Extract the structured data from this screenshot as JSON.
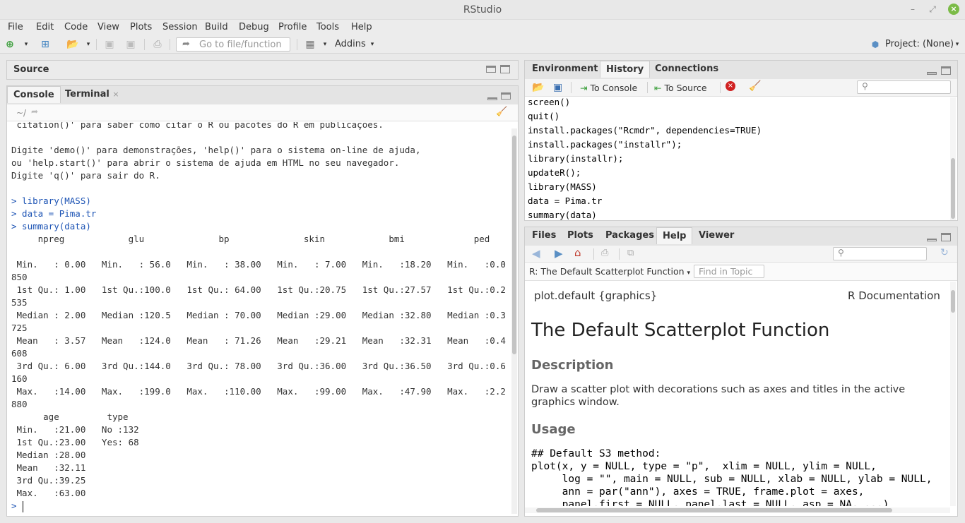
{
  "window": {
    "title": "RStudio"
  },
  "menu": [
    "File",
    "Edit",
    "Code",
    "View",
    "Plots",
    "Session",
    "Build",
    "Debug",
    "Profile",
    "Tools",
    "Help"
  ],
  "toolbar": {
    "goto_placeholder": "Go to file/function",
    "addins_label": "Addins",
    "project_label": "Project: (None)"
  },
  "source_pane": {
    "title": "Source"
  },
  "console_pane": {
    "tabs": [
      "Console",
      "Terminal"
    ],
    "path": "~/",
    "lines": [
      " citation()' para saber como citar o R ou pacotes do R em publicações.",
      "",
      "Digite 'demo()' para demonstrações, 'help()' para o sistema on-line de ajuda,",
      "ou 'help.start()' para abrir o sistema de ajuda em HTML no seu navegador.",
      "Digite 'q()' para sair do R.",
      "",
      "> library(MASS)",
      "> data = Pima.tr",
      "> summary(data)",
      "     npreg            glu              bp              skin            bmi             ped",
      "",
      " Min.   : 0.00   Min.   : 56.0   Min.   : 38.00   Min.   : 7.00   Min.   :18.20   Min.   :0.0",
      "850",
      " 1st Qu.: 1.00   1st Qu.:100.0   1st Qu.: 64.00   1st Qu.:20.75   1st Qu.:27.57   1st Qu.:0.2",
      "535",
      " Median : 2.00   Median :120.5   Median : 70.00   Median :29.00   Median :32.80   Median :0.3",
      "725",
      " Mean   : 3.57   Mean   :124.0   Mean   : 71.26   Mean   :29.21   Mean   :32.31   Mean   :0.4",
      "608",
      " 3rd Qu.: 6.00   3rd Qu.:144.0   3rd Qu.: 78.00   3rd Qu.:36.00   3rd Qu.:36.50   3rd Qu.:0.6",
      "160",
      " Max.   :14.00   Max.   :199.0   Max.   :110.00   Max.   :99.00   Max.   :47.90   Max.   :2.2",
      "880",
      "      age         type",
      " Min.   :21.00   No :132",
      " 1st Qu.:23.00   Yes: 68",
      " Median :28.00",
      " Mean   :32.11",
      " 3rd Qu.:39.25",
      " Max.   :63.00",
      "> "
    ]
  },
  "history_pane": {
    "tabs": [
      "Environment",
      "History",
      "Connections"
    ],
    "to_console": "To Console",
    "to_source": "To Source",
    "lines": [
      "screen()",
      "quit()",
      "install.packages(\"Rcmdr\", dependencies=TRUE)",
      "install.packages(\"installr\");",
      "library(installr);",
      "updateR();",
      "library(MASS)",
      "data = Pima.tr",
      "summary(data)"
    ]
  },
  "help_pane": {
    "tabs": [
      "Files",
      "Plots",
      "Packages",
      "Help",
      "Viewer"
    ],
    "topic": "R: The Default Scatterplot Function",
    "find_placeholder": "Find in Topic",
    "pkg": "plot.default {graphics}",
    "rdoc": "R Documentation",
    "title": "The Default Scatterplot Function",
    "desc_heading": "Description",
    "desc_text1": "Draw a scatter plot with decorations such as axes and titles in the active",
    "desc_text2": "graphics window.",
    "usage_heading": "Usage",
    "usage_lines": [
      "## Default S3 method:",
      "plot(x, y = NULL, type = \"p\",  xlim = NULL, ylim = NULL,",
      "     log = \"\", main = NULL, sub = NULL, xlab = NULL, ylab = NULL,",
      "     ann = par(\"ann\"), axes = TRUE, frame.plot = axes,",
      "     panel.first = NULL, panel.last = NULL, asp = NA, ...)"
    ]
  }
}
